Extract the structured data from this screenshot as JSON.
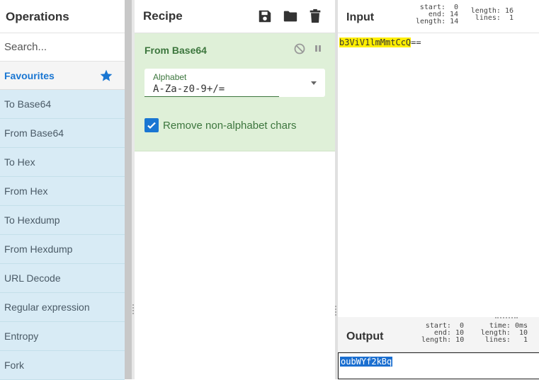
{
  "operations": {
    "title": "Operations",
    "search_placeholder": "Search...",
    "favourites_label": "Favourites",
    "items": [
      "To Base64",
      "From Base64",
      "To Hex",
      "From Hex",
      "To Hexdump",
      "From Hexdump",
      "URL Decode",
      "Regular expression",
      "Entropy",
      "Fork"
    ]
  },
  "recipe": {
    "title": "Recipe",
    "operation": {
      "name": "From Base64",
      "alphabet_label": "Alphabet",
      "alphabet_value": "A-Za-z0-9+/=",
      "remove_label": "Remove non-alphabet chars",
      "remove_checked": true
    }
  },
  "input": {
    "title": "Input",
    "stats": {
      "start": "0",
      "end": "14",
      "length_sel": "14",
      "length": "16",
      "lines": "1"
    },
    "text_highlighted": "b3ViV1lmMmtCcQ",
    "text_rest": "=="
  },
  "output": {
    "title": "Output",
    "stats": {
      "start": "0",
      "end": "10",
      "length_sel": "10",
      "time": "0ms",
      "length": "10",
      "lines": "1"
    },
    "text": "oubWYf2kBq"
  },
  "colors": {
    "accent": "#1976d2",
    "operation_bg": "#dff0d8",
    "operation_text": "#3c763d",
    "op_list_bg": "#d8ebf5",
    "highlight": "#ffee00"
  }
}
